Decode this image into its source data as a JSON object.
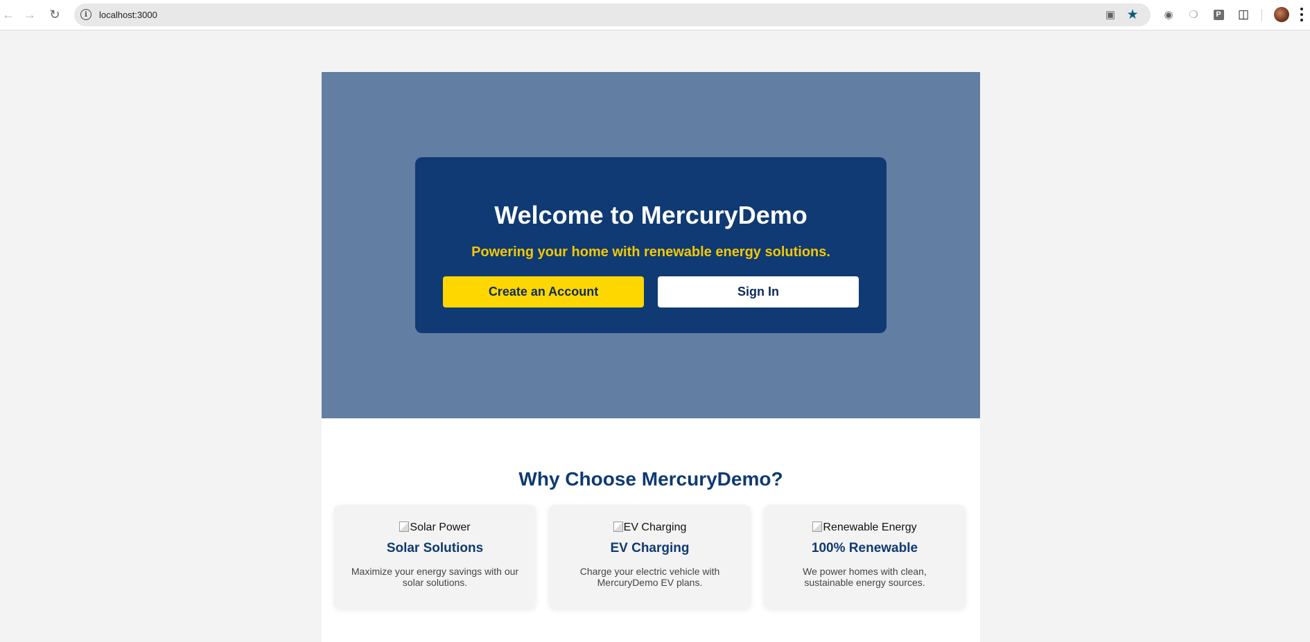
{
  "browser": {
    "url": "localhost:3000",
    "icons": {
      "back": "arrow-left-icon",
      "forward": "arrow-right-icon",
      "reload": "reload-icon",
      "site_info": "info-icon",
      "install": "install-app-icon",
      "bookmark": "star-icon",
      "camera": "camera-icon",
      "extension_gray": "puzzle-icon",
      "profile": "avatar",
      "menu": "kebab-menu-icon"
    },
    "p_extension_label": "P"
  },
  "hero": {
    "title": "Welcome to MercuryDemo",
    "subtitle": "Powering your home with renewable energy solutions.",
    "primary_button": "Create an Account",
    "secondary_button": "Sign In",
    "colors": {
      "background": "#627ea2",
      "card": "#0f3a73",
      "accent": "#ffd700",
      "subtitle": "#f5c800"
    }
  },
  "features": {
    "title": "Why Choose MercuryDemo?",
    "items": [
      {
        "image_alt": "Solar Power",
        "name": "Solar Solutions",
        "description": "Maximize your energy savings with our solar solutions."
      },
      {
        "image_alt": "EV Charging",
        "name": "EV Charging",
        "description": "Charge your electric vehicle with MercuryDemo EV plans."
      },
      {
        "image_alt": "Renewable Energy",
        "name": "100% Renewable",
        "description": "We power homes with clean, sustainable energy sources."
      }
    ]
  }
}
